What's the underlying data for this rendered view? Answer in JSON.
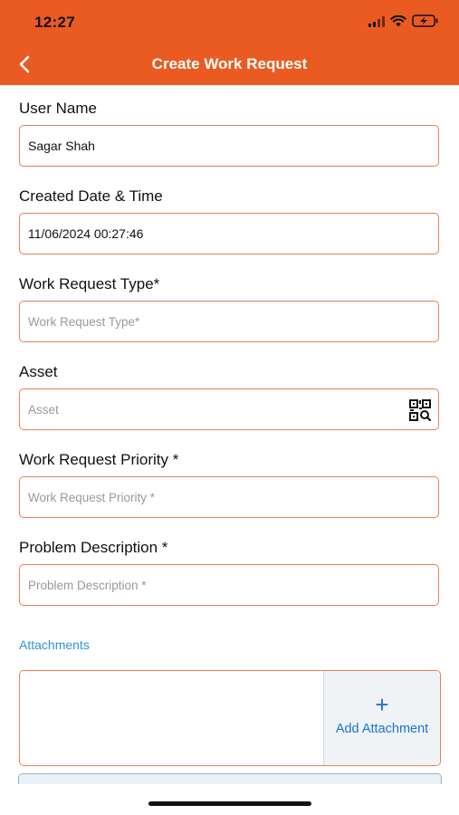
{
  "status_bar": {
    "time": "12:27",
    "icons": [
      "cellular-signal-icon",
      "wifi-icon",
      "battery-charging-icon"
    ]
  },
  "header": {
    "title": "Create Work Request",
    "back_icon": "chevron-left-icon",
    "background_color": "#ea5b22"
  },
  "form": {
    "user_name": {
      "label": "User Name",
      "value": "Sagar Shah"
    },
    "created_date_time": {
      "label": "Created Date & Time",
      "value": "11/06/2024 00:27:46"
    },
    "work_request_type": {
      "label": "Work Request Type*",
      "placeholder": "Work Request Type*"
    },
    "asset": {
      "label": "Asset",
      "placeholder": "Asset",
      "icon": "qr-scan-icon"
    },
    "work_request_priority": {
      "label": "Work Request Priority *",
      "placeholder": "Work Request Priority *"
    },
    "problem_description": {
      "label": "Problem Description *",
      "placeholder": "Problem Description *"
    }
  },
  "attachments": {
    "label": "Attachments",
    "add_button_icon": "+",
    "add_button_label": "Add Attachment"
  },
  "colors": {
    "accent": "#ea5b22",
    "field_border": "#e8805a",
    "link": "#2f95d4",
    "add_attachment": "#1a74d6"
  }
}
